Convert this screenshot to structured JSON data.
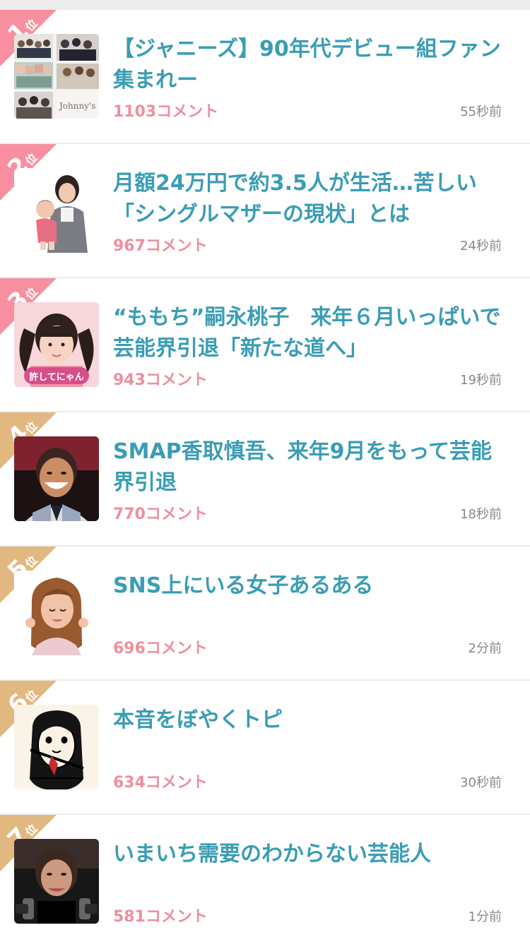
{
  "ranking": {
    "items": [
      {
        "rank": "1",
        "rank_unit": "位",
        "title": "【ジャニーズ】90年代デビュー組ファン集まれー",
        "comments": "1103コメント",
        "time": "55秒前",
        "ribbon_color": "#f78fa0",
        "thumbnail": "group-photo-collage-image"
      },
      {
        "rank": "2",
        "rank_unit": "位",
        "title": "月額24万円で約3.5人が生活…苦しい「シングルマザーの現状」とは",
        "comments": "967コメント",
        "time": "24秒前",
        "ribbon_color": "#f78fa0",
        "thumbnail": "mother-and-child-image"
      },
      {
        "rank": "3",
        "rank_unit": "位",
        "title": "“ももち”嗣永桃子　来年６月いっぱいで芸能界引退「新たな道へ」",
        "comments": "943コメント",
        "time": "19秒前",
        "ribbon_color": "#f78fa0",
        "thumbnail": "twin-tail-idol-image",
        "thumbnail_caption": "許してにゃん"
      },
      {
        "rank": "4",
        "rank_unit": "位",
        "title": "SMAP香取慎吾、来年9月をもって芸能界引退",
        "comments": "770コメント",
        "time": "18秒前",
        "ribbon_color": "#e2b881",
        "thumbnail": "smiling-man-portrait-image"
      },
      {
        "rank": "5",
        "rank_unit": "位",
        "title": "SNS上にいる女子あるある",
        "comments": "696コメント",
        "time": "2分前",
        "ribbon_color": "#e2b881",
        "thumbnail": "smiling-woman-image"
      },
      {
        "rank": "6",
        "rank_unit": "位",
        "title": "本音をぼやくトピ",
        "comments": "634コメント",
        "time": "30秒前",
        "ribbon_color": "#e2b881",
        "thumbnail": "manga-drawing-image"
      },
      {
        "rank": "7",
        "rank_unit": "位",
        "title": "いまいち需要のわからない芸能人",
        "comments": "581コメント",
        "time": "1分前",
        "ribbon_color": "#e2b881",
        "thumbnail": "press-conference-woman-image"
      }
    ]
  }
}
